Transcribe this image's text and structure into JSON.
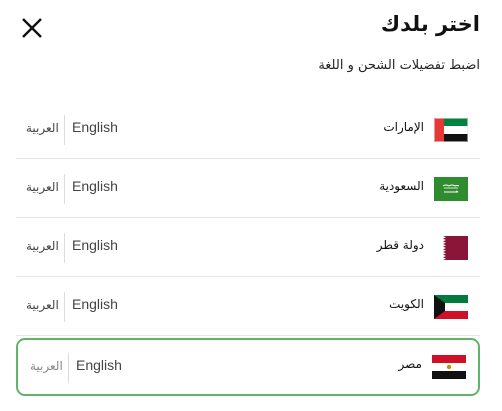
{
  "header": {
    "title": "اختر بلدك",
    "subtitle": "اضبط تفضيلات الشحن و اللغة"
  },
  "countries": [
    {
      "name": "الإمارات",
      "flag": "uae-flag-icon",
      "lang_en": "English",
      "lang_ar": "العربية"
    },
    {
      "name": "السعودية",
      "flag": "saudi-flag-icon",
      "lang_en": "English",
      "lang_ar": "العربية"
    },
    {
      "name": "دولة قطر",
      "flag": "qatar-flag-icon",
      "lang_en": "English",
      "lang_ar": "العربية"
    },
    {
      "name": "الكويت",
      "flag": "kuwait-flag-icon",
      "lang_en": "English",
      "lang_ar": "العربية"
    },
    {
      "name": "مصر",
      "flag": "egypt-flag-icon",
      "lang_en": "English",
      "lang_ar": "العربية"
    }
  ],
  "colors": {
    "selected_border": "#62b26a",
    "uae_red": "#e53935",
    "green": "#00843d",
    "saudi_green": "#2e8b2e",
    "qatar_maroon": "#8a1538",
    "kuwait_green": "#007a3d",
    "kuwait_red": "#ce1126",
    "egypt_red": "#ce1126"
  }
}
